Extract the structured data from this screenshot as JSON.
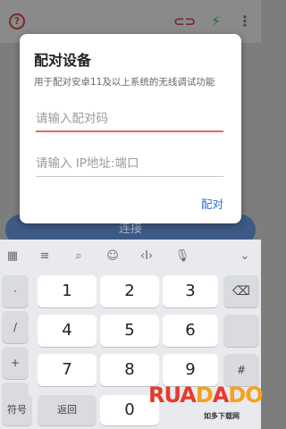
{
  "background": {
    "button_label": "连接"
  },
  "dialog": {
    "title": "配对设备",
    "description": "用于配对安卓11及以上系统的无线调试功能",
    "code_placeholder": "请输入配对码",
    "address_placeholder": "请输入 IP地址:端口",
    "pair_button": "配对"
  },
  "keyboard": {
    "side_keys": [
      "·",
      "/",
      "+",
      "-"
    ],
    "rows": [
      [
        "1",
        "2",
        "3"
      ],
      [
        "4",
        "5",
        "6"
      ],
      [
        "7",
        "8",
        "9"
      ]
    ],
    "bottom": {
      "symbols": "符号",
      "back": "返回",
      "zero": "0"
    },
    "hash": "#"
  },
  "watermark": {
    "text": "RUADADO",
    "subtitle": "如多下载网"
  },
  "colors": {
    "accent": "#2f6fd6",
    "focus_line": "#e06b6b"
  }
}
